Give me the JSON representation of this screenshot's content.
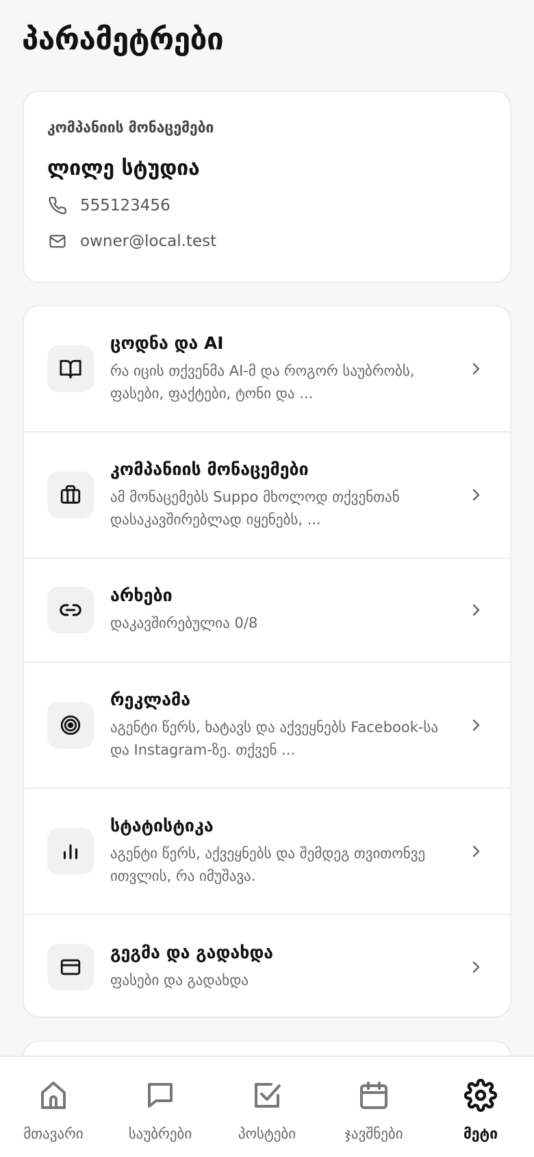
{
  "page": {
    "title": "პარამეტრები"
  },
  "company": {
    "caption": "კომპანიის მონაცემები",
    "name": "ლილე სტუდია",
    "phone": "555123456",
    "email": "owner@local.test"
  },
  "menu": {
    "items": [
      {
        "icon": "book-icon",
        "title": "ცოდნა და AI",
        "description": "რა იცის თქვენმა AI-მ და როგორ საუბრობს, ფასები, ფაქტები, ტონი და ..."
      },
      {
        "icon": "briefcase-icon",
        "title": "კომპანიის მონაცემები",
        "description": "ამ მონაცემებს Suppo მხოლოდ თქვენთან დასაკავშირებლად იყენებს, ..."
      },
      {
        "icon": "link-icon",
        "title": "არხები",
        "description": "დაკავშირებულია 0/8"
      },
      {
        "icon": "target-icon",
        "title": "რეკლამა",
        "description": "აგენტი წერს, ხატავს და აქვეყნებს Facebook-სა და Instagram-ზე. თქვენ ..."
      },
      {
        "icon": "bar-chart-icon",
        "title": "სტატისტიკა",
        "description": "აგენტი წერს, აქვეყნებს და შემდეგ თვითონვე ითვლის, რა იმუშავა."
      },
      {
        "icon": "credit-card-icon",
        "title": "გეგმა და გადახდა",
        "description": "ფასები და გადახდა"
      }
    ]
  },
  "nav": {
    "items": [
      {
        "icon": "home-icon",
        "label": "მთავარი"
      },
      {
        "icon": "chat-icon",
        "label": "საუბრები"
      },
      {
        "icon": "check-square-icon",
        "label": "პოსტები"
      },
      {
        "icon": "calendar-icon",
        "label": "ჯავშნები"
      },
      {
        "icon": "gear-icon",
        "label": "მეტი",
        "active": true
      }
    ]
  }
}
